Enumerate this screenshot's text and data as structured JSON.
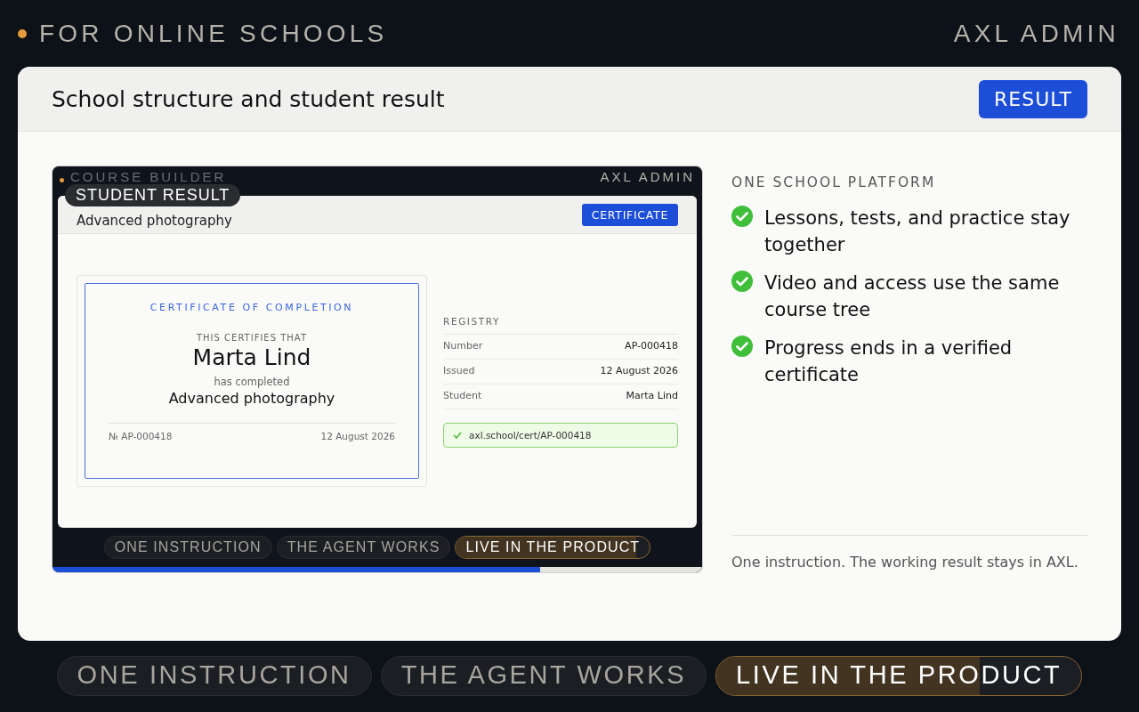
{
  "header": {
    "tagline": "FOR ONLINE SCHOOLS",
    "brand": "AXL ADMIN"
  },
  "panel": {
    "title": "School structure and student result",
    "button": "RESULT"
  },
  "preview": {
    "caption": "COURSE BUILDER",
    "brand": "AXL ADMIN",
    "badge": "STUDENT RESULT",
    "course": "Advanced photography",
    "button": "CERTIFICATE",
    "certificate": {
      "heading": "CERTIFICATE OF COMPLETION",
      "intro": "THIS CERTIFIES THAT",
      "name": "Marta Lind",
      "completed": "has completed",
      "course": "Advanced photography",
      "number": "№ AP-000418",
      "date": "12 August 2026"
    },
    "registry": {
      "title": "REGISTRY",
      "rows": [
        {
          "label": "Number",
          "value": "AP-000418"
        },
        {
          "label": "Issued",
          "value": "12 August 2026"
        },
        {
          "label": "Student",
          "value": "Marta Lind"
        }
      ],
      "link": "axl.school/cert/AP-000418"
    },
    "tabs": [
      {
        "label": "ONE INSTRUCTION",
        "selected": false
      },
      {
        "label": "THE AGENT WORKS",
        "selected": false
      },
      {
        "label": "LIVE IN THE PRODUCT",
        "selected": true,
        "level": 0.93
      }
    ],
    "progress": {
      "level": 0.75
    }
  },
  "features": {
    "title": "ONE SCHOOL PLATFORM",
    "items": [
      "Lessons, tests, and practice stay together",
      "Video and access use the same course tree",
      "Progress ends in a verified certificate"
    ],
    "note": "One instruction. The working result stays in AXL."
  },
  "tabs": [
    {
      "label": "ONE INSTRUCTION",
      "selected": false
    },
    {
      "label": "THE AGENT WORKS",
      "selected": false
    },
    {
      "label": "LIVE IN THE PRODUCT",
      "selected": true,
      "level": 0.72
    }
  ]
}
